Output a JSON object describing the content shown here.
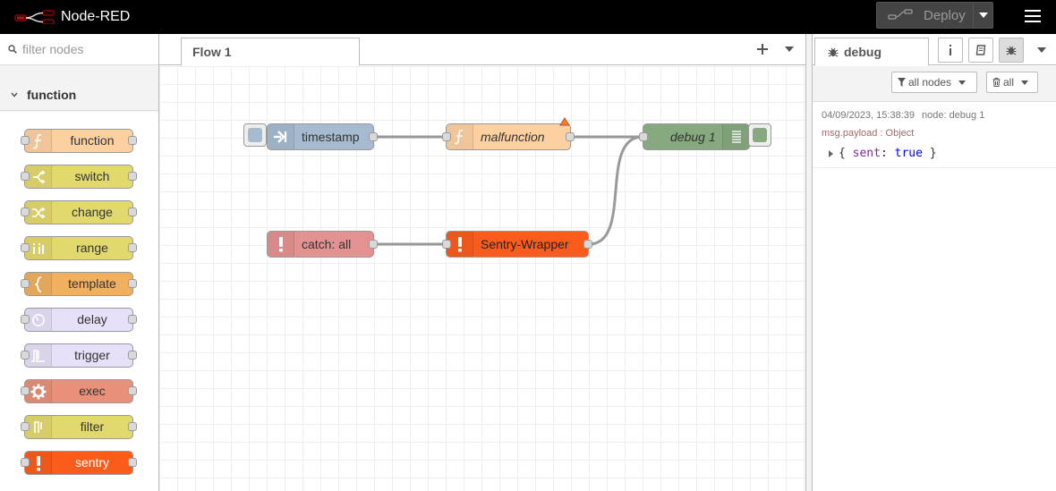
{
  "app": {
    "title": "Node-RED"
  },
  "header": {
    "deploy_label": "Deploy"
  },
  "palette": {
    "search_placeholder": "filter nodes",
    "category": "function",
    "nodes": [
      {
        "label": "function",
        "color": "#fdd0a2",
        "icon": "function-icon"
      },
      {
        "label": "switch",
        "color": "#e2d96e",
        "icon": "switch-icon"
      },
      {
        "label": "change",
        "color": "#e2d96e",
        "icon": "shuffle-icon"
      },
      {
        "label": "range",
        "color": "#e2d96e",
        "icon": "range-icon"
      },
      {
        "label": "template",
        "color": "#f0b060",
        "icon": "template-icon"
      },
      {
        "label": "delay",
        "color": "#e6e0f8",
        "icon": "timer-icon"
      },
      {
        "label": "trigger",
        "color": "#e6e0f8",
        "icon": "trigger-icon"
      },
      {
        "label": "exec",
        "color": "#e8907a",
        "icon": "gear-icon"
      },
      {
        "label": "filter",
        "color": "#e2d96e",
        "icon": "filter-icon"
      },
      {
        "label": "sentry",
        "color": "#fb5c1c",
        "icon": "alert-icon"
      }
    ]
  },
  "workspace": {
    "tabs": [
      {
        "label": "Flow 1"
      }
    ],
    "flow_nodes": {
      "timestamp": {
        "label": "timestamp",
        "color": "#a6bbcf"
      },
      "malfunction": {
        "label": "malfunction",
        "color": "#fdd0a2"
      },
      "debug": {
        "label": "debug 1",
        "color": "#87a980"
      },
      "catch": {
        "label": "catch: all",
        "color": "#e49191"
      },
      "sentry": {
        "label": "Sentry-Wrapper",
        "color": "#fb5c1c"
      }
    }
  },
  "sidebar": {
    "active_tab": "debug",
    "filter_label": "all nodes",
    "clear_label": "all",
    "messages": [
      {
        "timestamp": "04/09/2023, 15:38:39",
        "node": "node: debug 1",
        "topic": "msg.payload : Object",
        "value_open": "{",
        "key": "sent",
        "sep": ":",
        "value": "true",
        "value_close": "}"
      }
    ]
  }
}
